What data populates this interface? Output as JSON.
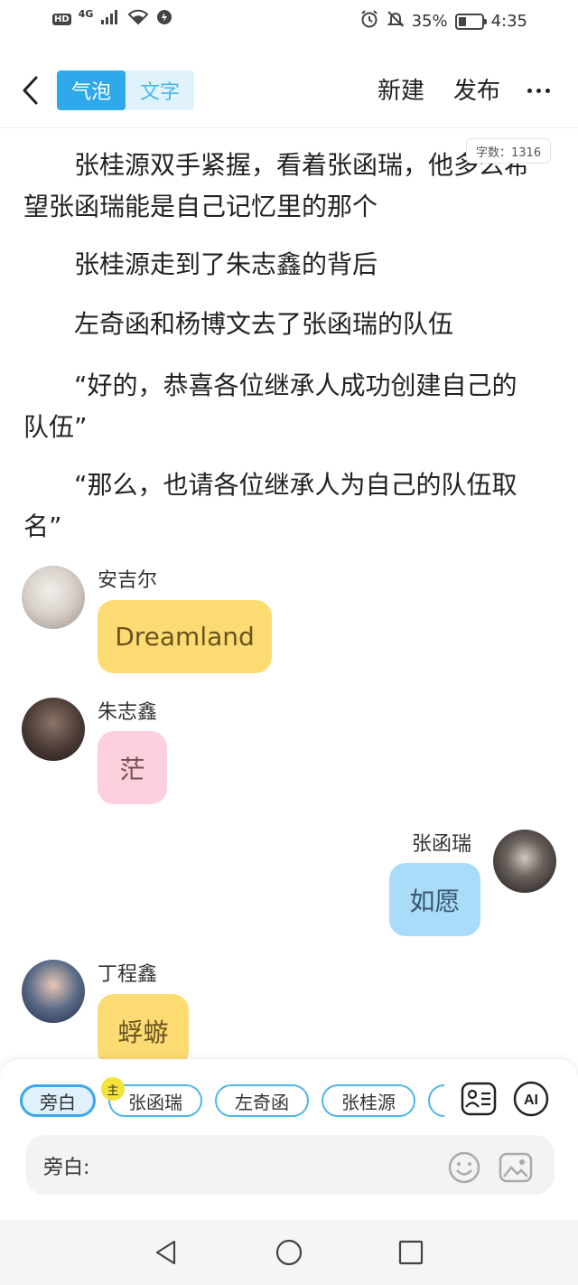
{
  "status_bar": {
    "hd": "HD",
    "network": "4G",
    "battery_percent": "35%",
    "battery_level": 0.35,
    "time": "4:35"
  },
  "header": {
    "mode_tabs": [
      "气泡",
      "文字"
    ],
    "active_tab": "气泡",
    "new_label": "新建",
    "publish_label": "发布"
  },
  "word_count": "字数：1316",
  "paragraphs": [
    "张桂源双手紧握，看着张函瑞，他多么希望张函瑞能是自己记忆里的那个",
    "张桂源走到了朱志鑫的背后",
    "左奇函和杨博文去了张函瑞的队伍",
    "“好的，恭喜各位继承人成功创建自己的队伍”",
    "“那么，也请各位继承人为自己的队伍取名”"
  ],
  "messages": [
    {
      "name": "安吉尔",
      "text": "Dreamland",
      "side": "left",
      "bubble_color": "#fcdc72"
    },
    {
      "name": "朱志鑫",
      "text": "茫",
      "side": "left",
      "bubble_color": "#fcd0dc"
    },
    {
      "name": "张函瑞",
      "text": "如愿",
      "side": "right",
      "bubble_color": "#a8dcf8"
    },
    {
      "name": "丁程鑫",
      "text": "蜉蝣",
      "side": "left",
      "bubble_color": "#fcdc72"
    }
  ],
  "role_chips": [
    "旁白",
    "张函瑞",
    "左奇函",
    "张桂源"
  ],
  "host_badge": "主",
  "input": {
    "label": "旁白:"
  },
  "colors": {
    "accent": "#2fa8ec",
    "chip_border": "#4cb6e8"
  }
}
